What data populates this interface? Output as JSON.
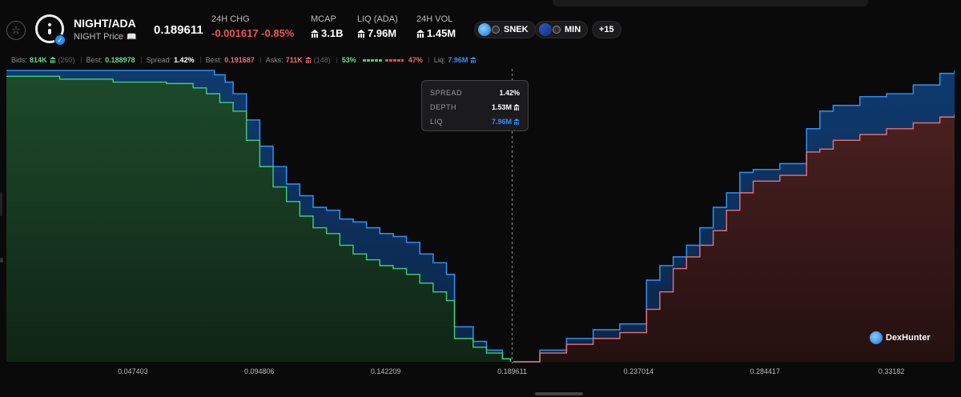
{
  "header": {
    "pair_name": "NIGHT/ADA",
    "pair_sub": "NIGHT Price",
    "price": "0.189611",
    "stats": [
      {
        "label": "24H CHG",
        "value": "-0.001617 -0.85%",
        "negative": true
      },
      {
        "label": "MCAP",
        "value": "3.1B"
      },
      {
        "label": "LIQ (ADA)",
        "value": "7.96M"
      },
      {
        "label": "24H VOL",
        "value": "1.45M"
      }
    ],
    "chips": [
      {
        "label": "SNEK",
        "icon": "snek-token-icon"
      },
      {
        "label": "MIN",
        "icon": "min-token-icon"
      },
      {
        "label": "+15"
      }
    ]
  },
  "statbar": {
    "bids_label": "Bids:",
    "bids_value": "814K",
    "bids_count": "(260)",
    "best_bid_label": "Best:",
    "best_bid_value": "0.188978",
    "spread_label": "Spread:",
    "spread_value": "1.42%",
    "best_ask_label": "Best:",
    "best_ask_value": "0.191687",
    "asks_label": "Asks:",
    "asks_value": "711K",
    "asks_count": "(148)",
    "bid_pct": "53%",
    "ask_pct": "47%",
    "liq_label": "Liq:",
    "liq_value": "7.96M"
  },
  "tooltip": {
    "spread_label": "SPREAD",
    "spread_value": "1.42%",
    "depth_label": "DEPTH",
    "depth_value": "1.53M",
    "liq_label": "LIQ",
    "liq_value": "7.96M"
  },
  "brand": "DexHunter",
  "colors": {
    "bid": "#3fcf73",
    "ask": "#e57373",
    "liquidity": "#2b8cf0",
    "negative": "#f05454"
  },
  "chart_data": {
    "type": "area",
    "x_ticks": [
      "0.047403",
      "0.094806",
      "0.142209",
      "0.189611",
      "0.237014",
      "0.284417",
      "0.33182"
    ],
    "xlim": [
      0.0,
      0.3555
    ],
    "mid_price": 0.189611,
    "series": [
      {
        "role": "bids",
        "points": [
          [
            0.0,
            0.98
          ],
          [
            0.02,
            0.97
          ],
          [
            0.04,
            0.96
          ],
          [
            0.06,
            0.955
          ],
          [
            0.07,
            0.94
          ],
          [
            0.075,
            0.92
          ],
          [
            0.08,
            0.89
          ],
          [
            0.085,
            0.86
          ],
          [
            0.09,
            0.76
          ],
          [
            0.095,
            0.67
          ],
          [
            0.1,
            0.6
          ],
          [
            0.105,
            0.55
          ],
          [
            0.11,
            0.5
          ],
          [
            0.115,
            0.46
          ],
          [
            0.12,
            0.44
          ],
          [
            0.125,
            0.4
          ],
          [
            0.13,
            0.37
          ],
          [
            0.135,
            0.35
          ],
          [
            0.14,
            0.33
          ],
          [
            0.145,
            0.32
          ],
          [
            0.15,
            0.3
          ],
          [
            0.155,
            0.27
          ],
          [
            0.16,
            0.24
          ],
          [
            0.165,
            0.21
          ],
          [
            0.168,
            0.08
          ],
          [
            0.175,
            0.05
          ],
          [
            0.18,
            0.03
          ],
          [
            0.186,
            0.01
          ],
          [
            0.189,
            0.0
          ]
        ]
      },
      {
        "role": "bids-liquidity",
        "points": [
          [
            0.0,
            1.0
          ],
          [
            0.07,
            1.0
          ],
          [
            0.078,
            0.985
          ],
          [
            0.082,
            0.96
          ],
          [
            0.085,
            0.92
          ],
          [
            0.09,
            0.83
          ],
          [
            0.095,
            0.74
          ],
          [
            0.1,
            0.67
          ],
          [
            0.105,
            0.61
          ],
          [
            0.11,
            0.57
          ],
          [
            0.115,
            0.53
          ],
          [
            0.12,
            0.52
          ],
          [
            0.125,
            0.49
          ],
          [
            0.13,
            0.48
          ],
          [
            0.135,
            0.46
          ],
          [
            0.14,
            0.44
          ],
          [
            0.145,
            0.43
          ],
          [
            0.15,
            0.41
          ],
          [
            0.155,
            0.37
          ],
          [
            0.16,
            0.34
          ],
          [
            0.165,
            0.3
          ],
          [
            0.168,
            0.12
          ],
          [
            0.175,
            0.07
          ],
          [
            0.18,
            0.04
          ],
          [
            0.186,
            0.01
          ],
          [
            0.189,
            0.0
          ]
        ]
      },
      {
        "role": "asks",
        "points": [
          [
            0.19,
            0.0
          ],
          [
            0.2,
            0.03
          ],
          [
            0.21,
            0.06
          ],
          [
            0.22,
            0.08
          ],
          [
            0.23,
            0.1
          ],
          [
            0.24,
            0.18
          ],
          [
            0.245,
            0.24
          ],
          [
            0.25,
            0.32
          ],
          [
            0.255,
            0.36
          ],
          [
            0.26,
            0.4
          ],
          [
            0.265,
            0.45
          ],
          [
            0.27,
            0.52
          ],
          [
            0.275,
            0.58
          ],
          [
            0.28,
            0.62
          ],
          [
            0.29,
            0.64
          ],
          [
            0.3,
            0.72
          ],
          [
            0.305,
            0.73
          ],
          [
            0.31,
            0.76
          ],
          [
            0.32,
            0.78
          ],
          [
            0.33,
            0.8
          ],
          [
            0.34,
            0.82
          ],
          [
            0.35,
            0.84
          ],
          [
            0.3555,
            0.85
          ]
        ]
      },
      {
        "role": "asks-liquidity",
        "points": [
          [
            0.19,
            0.0
          ],
          [
            0.2,
            0.04
          ],
          [
            0.21,
            0.08
          ],
          [
            0.22,
            0.11
          ],
          [
            0.23,
            0.13
          ],
          [
            0.24,
            0.28
          ],
          [
            0.245,
            0.33
          ],
          [
            0.25,
            0.36
          ],
          [
            0.255,
            0.4
          ],
          [
            0.26,
            0.46
          ],
          [
            0.265,
            0.53
          ],
          [
            0.27,
            0.58
          ],
          [
            0.275,
            0.65
          ],
          [
            0.28,
            0.66
          ],
          [
            0.29,
            0.68
          ],
          [
            0.3,
            0.8
          ],
          [
            0.305,
            0.86
          ],
          [
            0.31,
            0.88
          ],
          [
            0.32,
            0.91
          ],
          [
            0.33,
            0.92
          ],
          [
            0.34,
            0.95
          ],
          [
            0.35,
            0.99
          ],
          [
            0.3555,
            1.0
          ]
        ]
      }
    ]
  }
}
